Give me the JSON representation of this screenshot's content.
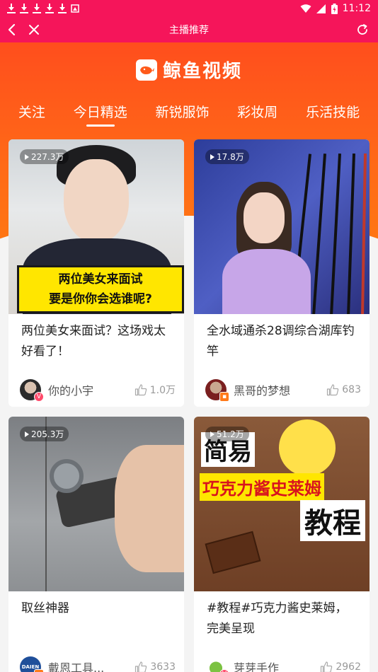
{
  "status_bar": {
    "time": "11:12",
    "colors": {
      "bar": "#f5155a"
    }
  },
  "nav": {
    "title": "主播推荐",
    "back_icon": "chevron-left-icon",
    "close_icon": "close-icon",
    "refresh_icon": "refresh-icon"
  },
  "brand": {
    "name": "鲸鱼视频",
    "accent": "#ff5a1a"
  },
  "tabs": [
    {
      "label": "关注",
      "active": false
    },
    {
      "label": "今日精选",
      "active": true
    },
    {
      "label": "新锐服饰",
      "active": false
    },
    {
      "label": "彩妆周",
      "active": false
    },
    {
      "label": "乐活技能",
      "active": false
    }
  ],
  "cards": [
    {
      "views": "227.3万",
      "title": "两位美女来面试？这场戏太好看了！",
      "author": "你的小宇",
      "likes": "1.0万",
      "thumb_caption_1": "两位美女来面试",
      "thumb_caption_2": "要是你你会选谁呢?"
    },
    {
      "views": "17.8万",
      "title": "全水域通杀28调综合湖库钓竿",
      "author": "黑哥的梦想",
      "likes": "683"
    },
    {
      "views": "205.3万",
      "title": "取丝神器",
      "author": "戴恩工具...",
      "likes": "3633",
      "avatar_text": "DAIEN"
    },
    {
      "views": "51.2万",
      "title": "#教程#巧克力酱史莱姆，完美呈现",
      "author": "芽芽手作",
      "likes": "2962",
      "thumb_text_1": "简易",
      "thumb_text_2": "巧克力酱史莱姆",
      "thumb_text_3": "教程"
    }
  ]
}
